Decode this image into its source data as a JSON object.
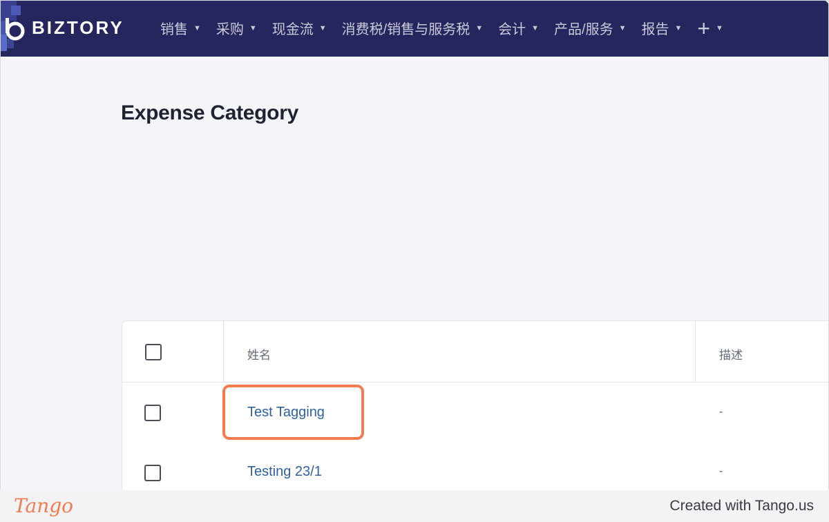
{
  "app": {
    "brand": "BIZTORY",
    "colors": {
      "nav_bg": "#26265e",
      "accent": "#f47c4c",
      "link": "#2f5fa3"
    }
  },
  "nav": {
    "items": [
      {
        "label": "销售",
        "icon": "caret-down-icon"
      },
      {
        "label": "采购",
        "icon": "caret-down-icon"
      },
      {
        "label": "现金流",
        "icon": "caret-down-icon"
      },
      {
        "label": "消费税/销售与服务税",
        "icon": "caret-down-icon"
      },
      {
        "label": "会计",
        "icon": "caret-down-icon"
      },
      {
        "label": "产品/服务",
        "icon": "caret-down-icon"
      },
      {
        "label": "报告",
        "icon": "caret-down-icon"
      }
    ],
    "add_button": {
      "label": "+",
      "icon": "plus-icon"
    }
  },
  "page": {
    "title": "Expense Category"
  },
  "table": {
    "headers": {
      "name": "姓名",
      "description": "描述"
    },
    "rows": [
      {
        "name": "Test Tagging",
        "description": "-",
        "highlighted": true
      },
      {
        "name": "Testing 23/1",
        "description": "-",
        "highlighted": false
      }
    ]
  },
  "footer": {
    "logo": "Tango",
    "text": "Created with Tango.us"
  }
}
